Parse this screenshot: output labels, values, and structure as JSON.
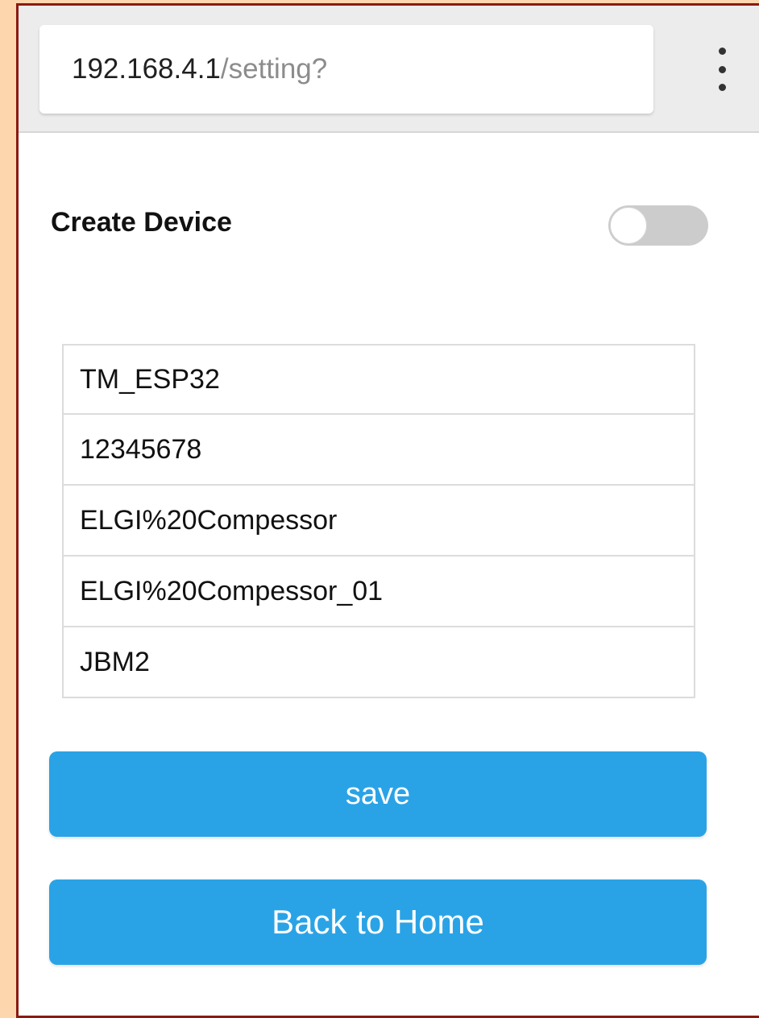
{
  "browser": {
    "url_host": "192.168.4.1",
    "url_path": "/setting?",
    "menu_icon": "more-vertical-icon"
  },
  "form": {
    "create_device_label": "Create Device",
    "create_device_enabled": false,
    "fields": [
      {
        "value": "TM_ESP32"
      },
      {
        "value": "12345678"
      },
      {
        "value": "ELGI%20Compessor"
      },
      {
        "value": "ELGI%20Compessor_01"
      },
      {
        "value": "JBM2"
      }
    ]
  },
  "buttons": {
    "save_label": "save",
    "home_label": "Back to Home",
    "color": "#2aa3e6"
  },
  "colors": {
    "page_background": "#fdd6ae",
    "frame_border": "#8a1a12",
    "toggle_off": "#cccccc"
  }
}
